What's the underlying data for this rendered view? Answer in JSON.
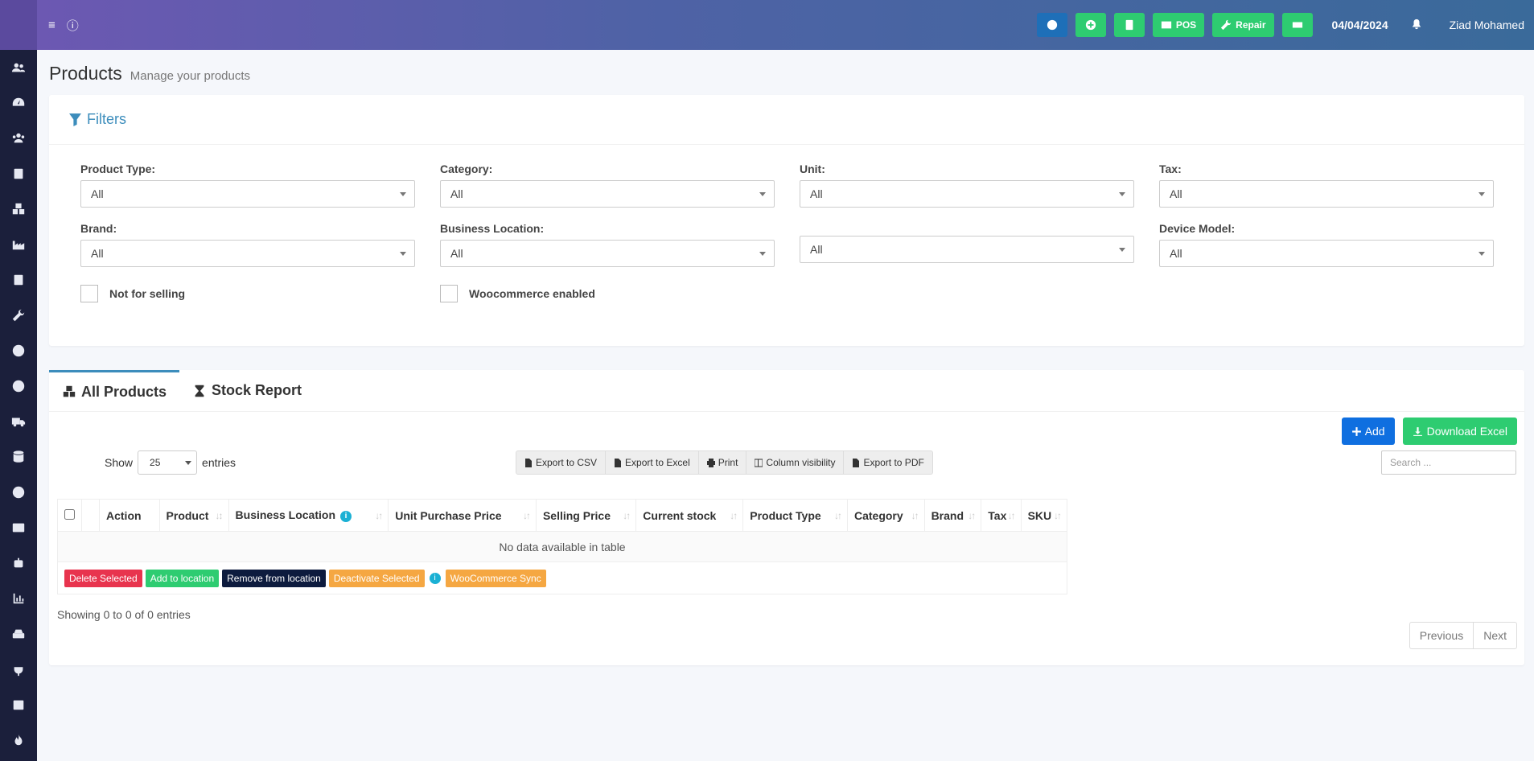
{
  "sidebar": {
    "icons": [
      "users-icon",
      "dashboard-icon",
      "contacts-icon",
      "address-book-icon",
      "cubes-icon",
      "industry-icon",
      "book-icon",
      "wrench-icon",
      "arrow-circle-down-icon",
      "arrow-circle-up-icon",
      "truck-icon",
      "database-icon",
      "minus-circle-icon",
      "id-card-icon",
      "robot-icon",
      "chart-icon",
      "hdd-icon",
      "plug-icon",
      "calendar-icon",
      "fire-icon"
    ]
  },
  "topbar": {
    "buttons": [
      {
        "icon": "download-circle-icon",
        "label": ""
      },
      {
        "icon": "plus-circle-icon",
        "label": ""
      },
      {
        "icon": "calculator-icon",
        "label": ""
      },
      {
        "icon": "pos-icon",
        "label": "POS"
      },
      {
        "icon": "wrench-icon",
        "label": "Repair"
      },
      {
        "icon": "money-icon",
        "label": ""
      }
    ],
    "date": "04/04/2024",
    "user": "Ziad Mohamed"
  },
  "page": {
    "title": "Products",
    "subtitle": "Manage your products"
  },
  "filters": {
    "heading": "Filters",
    "fields": [
      {
        "label": "Product Type:",
        "value": "All"
      },
      {
        "label": "Category:",
        "value": "All"
      },
      {
        "label": "Unit:",
        "value": "All"
      },
      {
        "label": "Tax:",
        "value": "All"
      },
      {
        "label": "Brand:",
        "value": "All"
      },
      {
        "label": "Business Location:",
        "value": "All"
      },
      {
        "label": "",
        "value": "All"
      },
      {
        "label": "Device Model:",
        "value": "All"
      }
    ],
    "checkboxes": [
      {
        "label": "Not for selling"
      },
      {
        "label": "Woocommerce enabled"
      }
    ]
  },
  "tabs": [
    {
      "label": "All Products",
      "icon": "cubes-icon"
    },
    {
      "label": "Stock Report",
      "icon": "hourglass-icon"
    }
  ],
  "toolbar": {
    "add_label": "Add",
    "download_label": "Download Excel",
    "show_label": "Show",
    "entries_value": "25",
    "entries_label": "entries",
    "search_placeholder": "Search ...",
    "exports": [
      "Export to CSV",
      "Export to Excel",
      "Print",
      "Column visibility",
      "Export to PDF"
    ]
  },
  "table": {
    "columns": [
      "Action",
      "Product",
      "Business Location",
      "Unit Purchase Price",
      "Selling Price",
      "Current stock",
      "Product Type",
      "Category",
      "Brand",
      "Tax",
      "SKU"
    ],
    "empty_text": "No data available in table"
  },
  "bulk_actions": {
    "delete": "Delete Selected",
    "add_location": "Add to location",
    "remove_location": "Remove from location",
    "deactivate": "Deactivate Selected",
    "woo_sync": "WooCommerce Sync"
  },
  "footer": {
    "showing": "Showing 0 to 0 of 0 entries",
    "previous": "Previous",
    "next": "Next"
  }
}
